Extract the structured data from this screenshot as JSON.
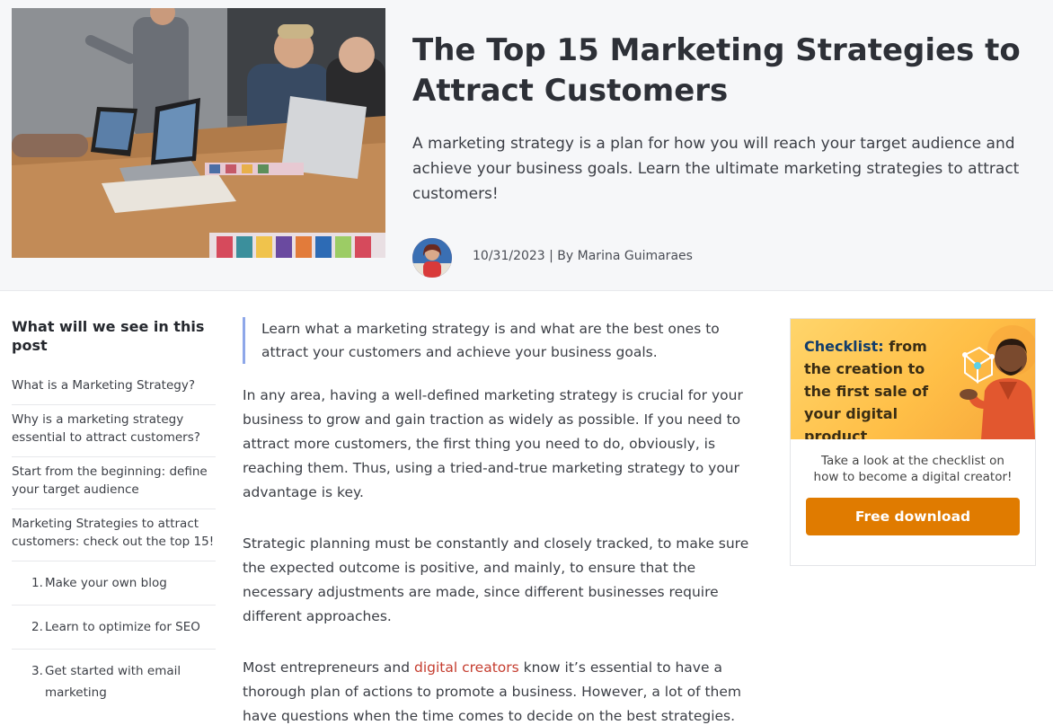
{
  "header": {
    "title": "The Top 15 Marketing Strategies to Attract Customers",
    "subtitle": "A marketing strategy is a plan for how you will reach your target audience and achieve your business goals. Learn the ultimate marketing strategies to attract customers!",
    "meta": "10/31/2023 | By Marina Guimaraes"
  },
  "toc": {
    "title": "What will we see in this post",
    "items": [
      "What is a Marketing Strategy?",
      "Why is a marketing strategy essential to attract customers?",
      "Start from the beginning: define your target audience",
      "Marketing Strategies to attract customers: check out the top 15!"
    ],
    "sub_items": [
      {
        "num": "1.",
        "label": "Make your own blog"
      },
      {
        "num": "2.",
        "label": "Learn to optimize for SEO"
      },
      {
        "num": "3.",
        "label": "Get started with email marketing"
      }
    ]
  },
  "article": {
    "lead": "Learn what a marketing strategy is and what are the best ones to attract your customers and achieve your business goals.",
    "p1": "In any area, having a well-defined marketing strategy is crucial for your business to grow and gain traction as widely as possible. If you need to attract more customers, the first thing you need to do, obviously, is reaching them. Thus, using a tried-and-true marketing strategy to your advantage is key.",
    "p2": "Strategic planning must be constantly and closely tracked, to make sure the expected outcome is positive, and mainly, to ensure that the necessary adjustments are made, since different businesses require different approaches.",
    "p3_before": "Most entrepreneurs and ",
    "p3_link": "digital creators",
    "p3_after": " know it’s essential to have a thorough plan of actions to promote a business. However, a lot of them have questions when the time comes to decide on the best strategies."
  },
  "cta": {
    "heading_accent": "Checklist:",
    "heading_rest": " from the creation to the first sale of your digital product",
    "text": "Take a look at the checklist on how to become a digital creator!",
    "button": "Free download"
  },
  "colors": {
    "accent_link": "#c53d2f",
    "cta_button": "#e07b00",
    "lead_border": "#8ea7e9"
  },
  "icons": [
    "hero-meeting-photo",
    "author-avatar",
    "cta-illustration"
  ]
}
